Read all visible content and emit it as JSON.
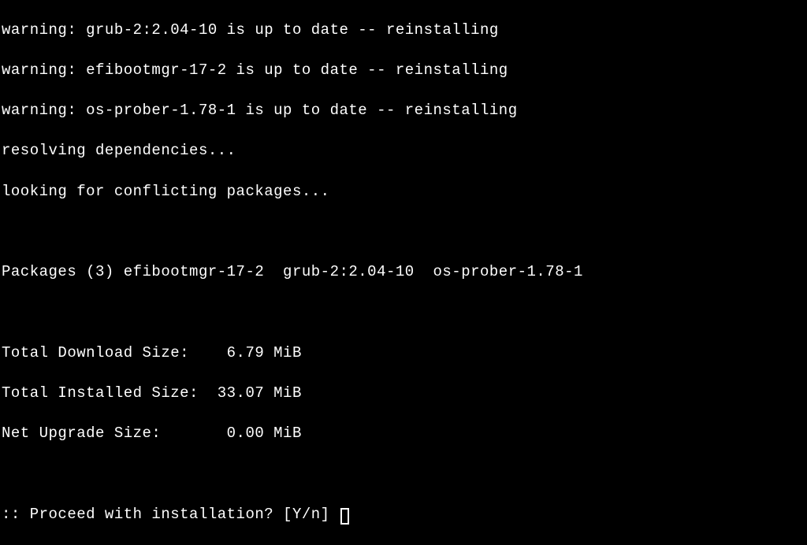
{
  "warnings": [
    "warning: grub-2:2.04-10 is up to date -- reinstalling",
    "warning: efibootmgr-17-2 is up to date -- reinstalling",
    "warning: os-prober-1.78-1 is up to date -- reinstalling"
  ],
  "status": {
    "resolving": "resolving dependencies...",
    "conflicts": "looking for conflicting packages..."
  },
  "packages_line": "Packages (3) efibootmgr-17-2  grub-2:2.04-10  os-prober-1.78-1",
  "sizes": {
    "download": "Total Download Size:    6.79 MiB",
    "installed": "Total Installed Size:  33.07 MiB",
    "upgrade": "Net Upgrade Size:       0.00 MiB"
  },
  "prompt": ":: Proceed with installation? [Y/n] "
}
